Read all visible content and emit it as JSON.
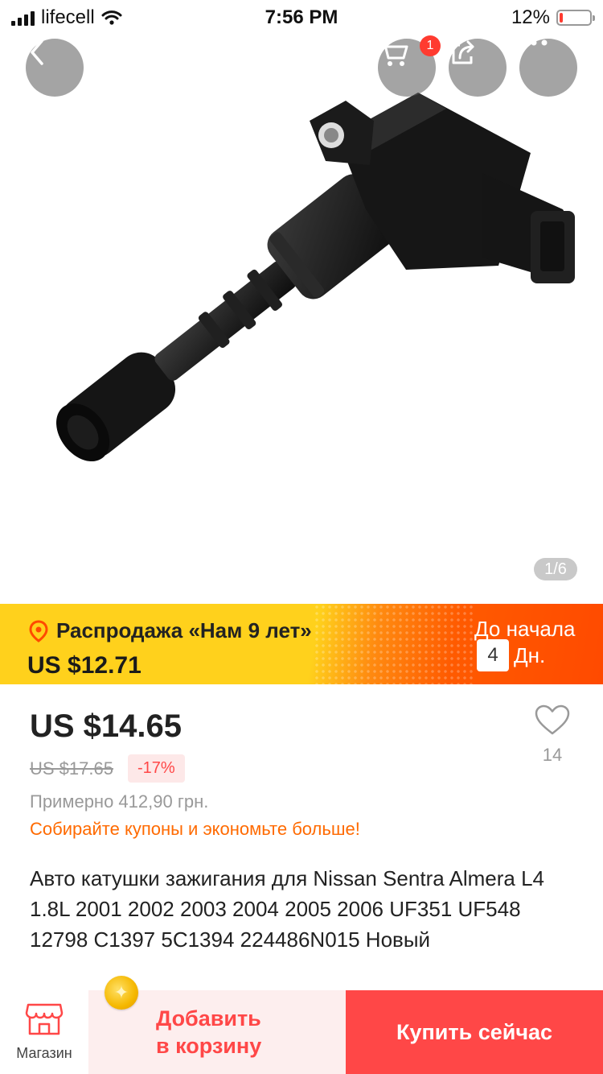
{
  "status_bar": {
    "carrier": "lifecell",
    "time": "7:56 PM",
    "battery": "12%",
    "battery_level": 0.12
  },
  "header": {
    "cart_badge": "1",
    "back_icon": "chevron-left-icon",
    "cart_icon": "cart-icon",
    "share_icon": "share-icon",
    "more_icon": "more-icon"
  },
  "gallery": {
    "counter": "1/6"
  },
  "sale_banner": {
    "title": "Распродажа «Нам 9 лет»",
    "price": "US $12.71",
    "countdown_label": "До начала",
    "days_value": "4",
    "days_unit": "Дн."
  },
  "product": {
    "price": "US $14.65",
    "old_price": "US $17.65",
    "discount": "-17%",
    "approx_local": "Примерно 412,90 грн.",
    "coupon_promo": "Собирайте купоны и экономьте больше!",
    "wishlist_count": "14",
    "title": "Авто катушки зажигания для Nissan Sentra Almera L4 1.8L 2001 2002 2003 2004 2005 2006 UF351 UF548 12798 C1397 5C1394 224486N015 Новый"
  },
  "bottom_bar": {
    "shop_label": "Магазин",
    "add_to_cart_line1": "Добавить",
    "add_to_cart_line2": "в корзину",
    "buy_now": "Купить сейчас"
  },
  "colors": {
    "accent": "#ff4747",
    "promo_orange": "#ff6a00",
    "banner_yellow": "#ffd11c"
  }
}
